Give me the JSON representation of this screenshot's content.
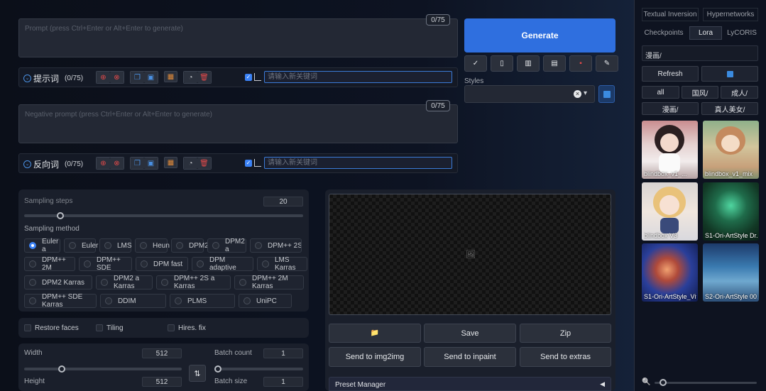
{
  "prompt": {
    "placeholder": "Prompt (press Ctrl+Enter or Alt+Enter to generate)",
    "counter": "0/75",
    "tag_label": "提示词",
    "tag_count": "(0/75)",
    "tag_input_placeholder": "请输入新关键词"
  },
  "negative": {
    "placeholder": "Negative prompt (press Ctrl+Enter or Alt+Enter to generate)",
    "counter": "0/75",
    "tag_label": "反向词",
    "tag_count": "(0/75)",
    "tag_input_placeholder": "请输入新关键词"
  },
  "generate": {
    "label": "Generate",
    "tools": [
      "✓",
      "▯",
      "▥",
      "▤",
      "▪",
      "✎"
    ],
    "styles_label": "Styles",
    "styles_clear": "×",
    "styles_arrow": "▾"
  },
  "sampling": {
    "steps_label": "Sampling steps",
    "steps_value": "20",
    "steps_fraction": 0.13,
    "method_label": "Sampling method",
    "methods": [
      "Euler a",
      "Euler",
      "LMS",
      "Heun",
      "DPM2",
      "DPM2 a",
      "DPM++ 2S a",
      "DPM++ 2M",
      "DPM++ SDE",
      "DPM fast",
      "DPM adaptive",
      "LMS Karras",
      "DPM2 Karras",
      "DPM2 a Karras",
      "DPM++ 2S a Karras",
      "DPM++ 2M Karras",
      "DPM++ SDE Karras",
      "DDIM",
      "PLMS",
      "UniPC"
    ],
    "selected": "Euler a"
  },
  "options": {
    "restore_faces": "Restore faces",
    "tiling": "Tiling",
    "hires_fix": "Hires. fix"
  },
  "dims": {
    "width_label": "Width",
    "width_value": "512",
    "height_label": "Height",
    "height_value": "512",
    "swap_icon": "⇅",
    "batch_count_label": "Batch count",
    "batch_count_value": "1",
    "batch_size_label": "Batch size",
    "batch_size_value": "1"
  },
  "output": {
    "image_icon": "🖼",
    "folder_icon": "📁",
    "save": "Save",
    "zip": "Zip",
    "send_img2img": "Send to img2img",
    "send_inpaint": "Send to inpaint",
    "send_extras": "Send to extras",
    "preset_manager": "Preset Manager",
    "preset_arrow": "◀"
  },
  "right": {
    "tabs_row1": [
      "Textual Inversion",
      "Hypernetworks"
    ],
    "tabs_row2": [
      "Checkpoints",
      "Lora",
      "LyCORIS"
    ],
    "active_tab": "Lora",
    "search_value": "漫画/",
    "refresh": "Refresh",
    "refresh_icon": "🔄",
    "filters_row1": [
      "all",
      "国风/",
      "成人/"
    ],
    "filters_row2": [
      "漫画/",
      "真人美女/"
    ],
    "cards": [
      "blindbox_v1_...",
      "blindbox_v1_mix",
      "blindbox V3",
      "S1-Ori-ArtStyle Dr...",
      "S1-Ori-ArtStyle_Vif...",
      "S2-Ori-ArtStyle 00..."
    ],
    "zoom_icon": "🔍",
    "zoom_fraction": 0.05
  }
}
